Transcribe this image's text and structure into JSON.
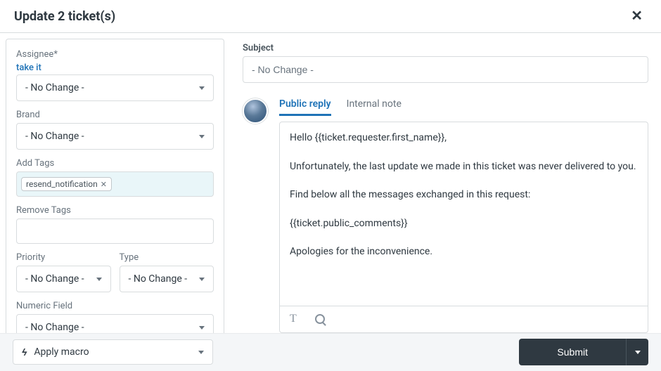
{
  "header": {
    "title": "Update 2 ticket(s)"
  },
  "sidebar": {
    "assignee": {
      "label": "Assignee*",
      "take_it": "take it",
      "value": "- No Change -"
    },
    "brand": {
      "label": "Brand",
      "value": "- No Change -"
    },
    "add_tags": {
      "label": "Add Tags",
      "chip": "resend_notification"
    },
    "remove_tags": {
      "label": "Remove Tags"
    },
    "priority": {
      "label": "Priority",
      "value": "- No Change -"
    },
    "type": {
      "label": "Type",
      "value": "- No Change -"
    },
    "numeric_field": {
      "label": "Numeric Field",
      "value": "- No Change -"
    }
  },
  "main": {
    "subject_label": "Subject",
    "subject_value": "- No Change -",
    "tabs": {
      "public_reply": "Public reply",
      "internal_note": "Internal note"
    },
    "comment_body": "Hello {{ticket.requester.first_name}},\n\nUnfortunately, the last update we made in this ticket was never delivered to you.\n\nFind below all the messages exchanged in this request:\n\n{{ticket.public_comments}}\n\nApologies for the inconvenience."
  },
  "footer": {
    "macro_label": "Apply macro",
    "submit_label": "Submit"
  }
}
